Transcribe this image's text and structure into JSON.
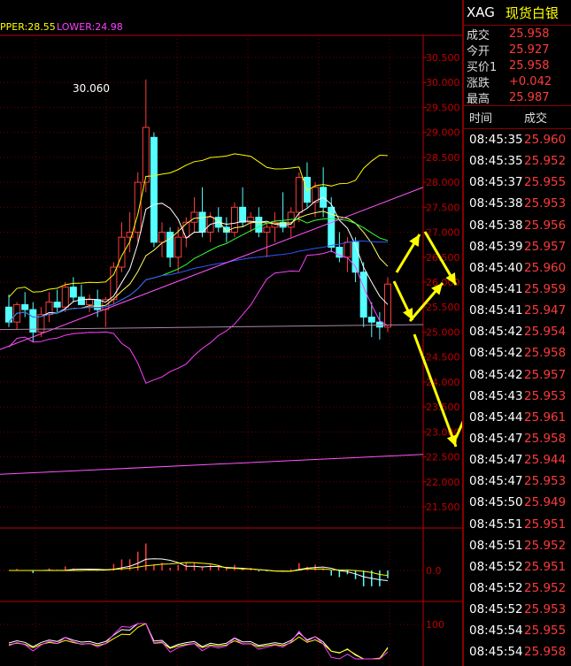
{
  "header": {
    "symbol": "XAG",
    "name": "现货白银"
  },
  "boll": {
    "upper_text": "PPER:28.55",
    "lower_text": "LOWER:24.98",
    "upper_color": "#ffff00",
    "lower_color": "#ff40ff"
  },
  "peak_label": "30.060",
  "price_axis": [
    "30.500",
    "30.000",
    "29.500",
    "29.000",
    "28.500",
    "28.000",
    "27.500",
    "27.000",
    "26.500",
    "26.000",
    "25.500",
    "25.000",
    "24.500",
    "24.000",
    "23.500",
    "23.000",
    "22.500",
    "22.000",
    "21.500"
  ],
  "macd_axis": "0.0",
  "kdj_axis": "100",
  "quote": [
    {
      "label": "成交",
      "value": "25.958"
    },
    {
      "label": "今开",
      "value": "25.927"
    },
    {
      "label": "买价1",
      "value": "25.958"
    },
    {
      "label": "涨跌",
      "value": "+0.042"
    },
    {
      "label": "最高",
      "value": "25.987"
    }
  ],
  "ticks_header": {
    "time": "时间",
    "price": "成交"
  },
  "ticks": [
    {
      "time": "08:45:35",
      "price": "25.960"
    },
    {
      "time": "08:45:35",
      "price": "25.952"
    },
    {
      "time": "08:45:37",
      "price": "25.955"
    },
    {
      "time": "08:45:38",
      "price": "25.953"
    },
    {
      "time": "08:45:38",
      "price": "25.956"
    },
    {
      "time": "08:45:39",
      "price": "25.957"
    },
    {
      "time": "08:45:40",
      "price": "25.960"
    },
    {
      "time": "08:45:41",
      "price": "25.959"
    },
    {
      "time": "08:45:41",
      "price": "25.947"
    },
    {
      "time": "08:45:42",
      "price": "25.954"
    },
    {
      "time": "08:45:42",
      "price": "25.958"
    },
    {
      "time": "08:45:42",
      "price": "25.957"
    },
    {
      "time": "08:45:43",
      "price": "25.953"
    },
    {
      "time": "08:45:44",
      "price": "25.961"
    },
    {
      "time": "08:45:47",
      "price": "25.958"
    },
    {
      "time": "08:45:47",
      "price": "25.944"
    },
    {
      "time": "08:45:47",
      "price": "25.953"
    },
    {
      "time": "08:45:50",
      "price": "25.949"
    },
    {
      "time": "08:45:51",
      "price": "25.951"
    },
    {
      "time": "08:45:51",
      "price": "25.952"
    },
    {
      "time": "08:45:52",
      "price": "25.951"
    },
    {
      "time": "08:45:52",
      "price": "25.952"
    },
    {
      "time": "08:45:52",
      "price": "25.953"
    },
    {
      "time": "08:45:54",
      "price": "25.955"
    },
    {
      "time": "08:45:54",
      "price": "25.958"
    }
  ],
  "colors": {
    "up": "#ff3b3b",
    "down": "#54ffff",
    "axis": "#c00000",
    "grid": "#6a0000",
    "arrow": "#ffff00"
  },
  "candles": [
    {
      "o": 25.5,
      "h": 25.75,
      "l": 25.1,
      "c": 25.2
    },
    {
      "o": 25.2,
      "h": 25.6,
      "l": 25.05,
      "c": 25.55
    },
    {
      "o": 25.55,
      "h": 25.8,
      "l": 25.3,
      "c": 25.45
    },
    {
      "o": 25.45,
      "h": 25.6,
      "l": 24.8,
      "c": 25.0
    },
    {
      "o": 25.0,
      "h": 25.5,
      "l": 24.9,
      "c": 25.35
    },
    {
      "o": 25.35,
      "h": 25.8,
      "l": 25.2,
      "c": 25.6
    },
    {
      "o": 25.6,
      "h": 25.85,
      "l": 25.4,
      "c": 25.5
    },
    {
      "o": 25.5,
      "h": 26.0,
      "l": 25.4,
      "c": 25.9
    },
    {
      "o": 25.9,
      "h": 26.1,
      "l": 25.6,
      "c": 25.7
    },
    {
      "o": 25.7,
      "h": 25.95,
      "l": 25.55,
      "c": 25.55
    },
    {
      "o": 25.55,
      "h": 25.75,
      "l": 25.4,
      "c": 25.65
    },
    {
      "o": 25.65,
      "h": 25.85,
      "l": 25.3,
      "c": 25.45
    },
    {
      "o": 25.45,
      "h": 25.7,
      "l": 25.1,
      "c": 25.65
    },
    {
      "o": 25.65,
      "h": 26.4,
      "l": 25.55,
      "c": 26.3
    },
    {
      "o": 26.3,
      "h": 27.2,
      "l": 26.2,
      "c": 26.9
    },
    {
      "o": 26.9,
      "h": 27.4,
      "l": 26.6,
      "c": 27.0
    },
    {
      "o": 27.0,
      "h": 28.2,
      "l": 26.8,
      "c": 28.0
    },
    {
      "o": 28.0,
      "h": 30.06,
      "l": 27.8,
      "c": 29.1
    },
    {
      "o": 28.9,
      "h": 29.0,
      "l": 26.7,
      "c": 26.8
    },
    {
      "o": 26.8,
      "h": 27.2,
      "l": 26.5,
      "c": 27.0
    },
    {
      "o": 27.0,
      "h": 27.1,
      "l": 26.3,
      "c": 26.5
    },
    {
      "o": 26.5,
      "h": 27.1,
      "l": 26.2,
      "c": 26.9
    },
    {
      "o": 26.9,
      "h": 27.3,
      "l": 26.7,
      "c": 27.2
    },
    {
      "o": 27.2,
      "h": 27.7,
      "l": 27.0,
      "c": 27.4
    },
    {
      "o": 27.4,
      "h": 27.9,
      "l": 26.9,
      "c": 27.0
    },
    {
      "o": 27.0,
      "h": 27.4,
      "l": 26.8,
      "c": 27.3
    },
    {
      "o": 27.3,
      "h": 27.5,
      "l": 27.0,
      "c": 27.1
    },
    {
      "o": 27.1,
      "h": 27.3,
      "l": 26.8,
      "c": 27.0
    },
    {
      "o": 27.0,
      "h": 27.6,
      "l": 26.9,
      "c": 27.5
    },
    {
      "o": 27.5,
      "h": 27.9,
      "l": 27.1,
      "c": 27.2
    },
    {
      "o": 27.2,
      "h": 27.4,
      "l": 27.0,
      "c": 27.3
    },
    {
      "o": 27.3,
      "h": 27.5,
      "l": 26.9,
      "c": 27.0
    },
    {
      "o": 27.0,
      "h": 27.2,
      "l": 26.5,
      "c": 27.1
    },
    {
      "o": 27.1,
      "h": 27.4,
      "l": 26.8,
      "c": 27.2
    },
    {
      "o": 27.2,
      "h": 27.8,
      "l": 27.0,
      "c": 27.1
    },
    {
      "o": 27.1,
      "h": 27.5,
      "l": 26.9,
      "c": 27.4
    },
    {
      "o": 27.4,
      "h": 28.2,
      "l": 27.2,
      "c": 28.1
    },
    {
      "o": 28.1,
      "h": 28.4,
      "l": 27.5,
      "c": 27.6
    },
    {
      "o": 27.6,
      "h": 28.0,
      "l": 27.3,
      "c": 27.9
    },
    {
      "o": 27.9,
      "h": 28.3,
      "l": 27.3,
      "c": 27.5
    },
    {
      "o": 27.5,
      "h": 27.7,
      "l": 26.6,
      "c": 26.7
    },
    {
      "o": 26.7,
      "h": 27.0,
      "l": 26.4,
      "c": 26.5
    },
    {
      "o": 26.5,
      "h": 26.9,
      "l": 26.2,
      "c": 26.8
    },
    {
      "o": 26.8,
      "h": 26.9,
      "l": 26.0,
      "c": 26.2
    },
    {
      "o": 26.2,
      "h": 26.4,
      "l": 25.1,
      "c": 25.3
    },
    {
      "o": 25.3,
      "h": 25.6,
      "l": 24.9,
      "c": 25.2
    },
    {
      "o": 25.2,
      "h": 25.4,
      "l": 24.85,
      "c": 25.1
    },
    {
      "o": 25.1,
      "h": 26.1,
      "l": 25.0,
      "c": 25.96
    }
  ]
}
